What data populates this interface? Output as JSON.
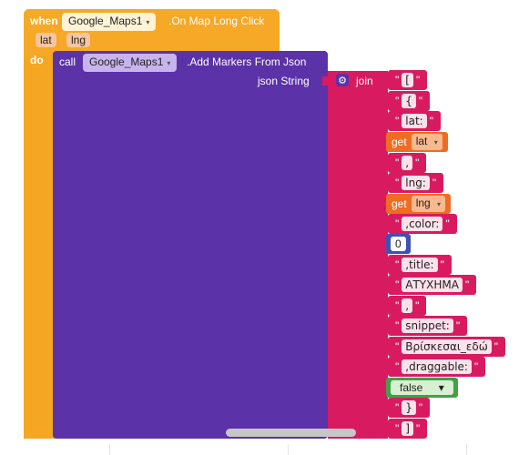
{
  "event": {
    "when_label": "when",
    "component": "Google_Maps1",
    "event_name": ".On Map Long Click",
    "params": [
      "lat",
      "lng"
    ],
    "do_label": "do"
  },
  "call": {
    "call_label": "call",
    "component": "Google_Maps1",
    "method": ".Add Markers From Json",
    "arg_label": "json String"
  },
  "join": {
    "label": "join",
    "items": [
      {
        "kind": "text",
        "value": "["
      },
      {
        "kind": "text",
        "value": "{"
      },
      {
        "kind": "text",
        "value": "lat:"
      },
      {
        "kind": "get",
        "label": "get",
        "value": "lat"
      },
      {
        "kind": "text",
        "value": ","
      },
      {
        "kind": "text",
        "value": "lng:"
      },
      {
        "kind": "get",
        "label": "get",
        "value": "lng"
      },
      {
        "kind": "text",
        "value": ",color:"
      },
      {
        "kind": "number",
        "value": "0"
      },
      {
        "kind": "text",
        "value": ",title:"
      },
      {
        "kind": "text",
        "value": "ΑΤΥΧΗΜΑ"
      },
      {
        "kind": "text",
        "value": ","
      },
      {
        "kind": "text",
        "value": "snippet:"
      },
      {
        "kind": "text",
        "value": "Βρίσκεσαι_εδώ"
      },
      {
        "kind": "text",
        "value": ",draggable:"
      },
      {
        "kind": "bool",
        "value": "false"
      },
      {
        "kind": "text",
        "value": "}"
      },
      {
        "kind": "text",
        "value": "]"
      }
    ]
  },
  "colors": {
    "event": "#f5a623",
    "procedure": "#5b32a8",
    "text": "#d81b60",
    "variable_get": "#ef6c23",
    "math": "#3f51b5",
    "logic": "#43a047"
  }
}
